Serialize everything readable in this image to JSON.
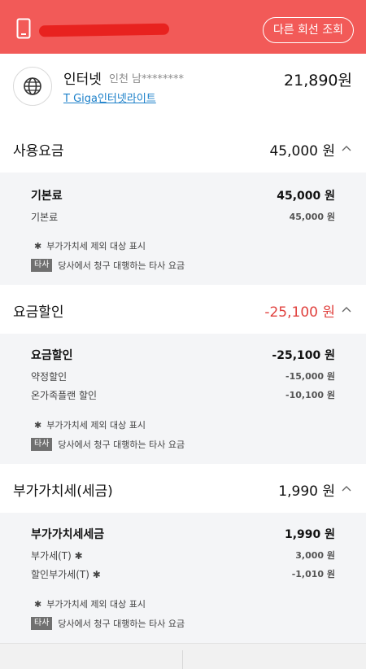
{
  "colors": {
    "header_bg": "#f25a58",
    "discount": "#e0403d",
    "link": "#1a7fc9",
    "panel_bg": "#f4f5f7"
  },
  "header": {
    "other_line_button": "다른 회선 조회"
  },
  "service": {
    "name": "인터넷",
    "location": "인천 남********",
    "plan": "T Giga인터넷라이트",
    "total": "21,890원"
  },
  "sections": {
    "usage": {
      "title": "사용요금",
      "amount": "45,000 원",
      "main_label": "기본료",
      "main_value": "45,000 원",
      "items": [
        {
          "label": "기본료",
          "value": "45,000 원"
        }
      ]
    },
    "discount": {
      "title": "요금할인",
      "amount": "-25,100 원",
      "main_label": "요금할인",
      "main_value": "-25,100 원",
      "items": [
        {
          "label": "약정할인",
          "value": "-15,000 원"
        },
        {
          "label": "온가족플랜 할인",
          "value": "-10,100 원"
        }
      ]
    },
    "vat": {
      "title": "부가가치세(세금)",
      "amount": "1,990 원",
      "main_label": "부가가치세세금",
      "main_value": "1,990 원",
      "items": [
        {
          "label": "부가세(T) ✱",
          "value": "3,000 원"
        },
        {
          "label": "할인부가세(T) ✱",
          "value": "-1,010 원"
        }
      ]
    }
  },
  "notes": {
    "star_symbol": "✱",
    "vat_excluded": "부가가치세 제외 대상 표시",
    "tag": "타사",
    "third_party": "당사에서 청구 대행하는 타사 요금"
  }
}
